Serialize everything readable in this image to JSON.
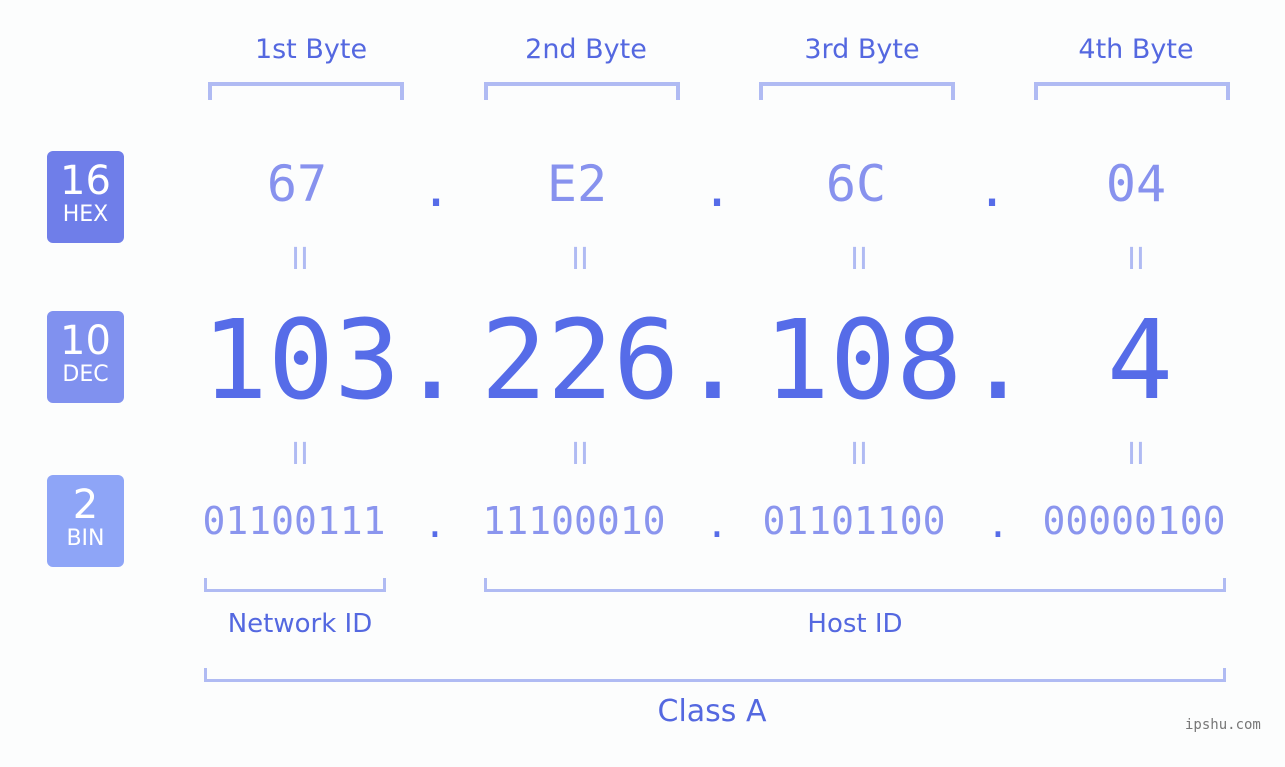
{
  "headers": [
    "1st Byte",
    "2nd Byte",
    "3rd Byte",
    "4th Byte"
  ],
  "badges": {
    "hex": {
      "number": "16",
      "label": "HEX",
      "color": "#6f7ee9"
    },
    "dec": {
      "number": "10",
      "label": "DEC",
      "color": "#8091ef"
    },
    "bin": {
      "number": "2",
      "label": "BIN",
      "color": "#8ea5f7"
    }
  },
  "hex": [
    "67",
    "E2",
    "6C",
    "04"
  ],
  "dec": [
    "103",
    "226",
    "108",
    "4"
  ],
  "bin": [
    "01100111",
    "11100010",
    "01101100",
    "00000100"
  ],
  "separator": ".",
  "equals": "II",
  "network_label": "Network ID",
  "host_label": "Host ID",
  "class_label": "Class A",
  "watermark": "ipshu.com"
}
